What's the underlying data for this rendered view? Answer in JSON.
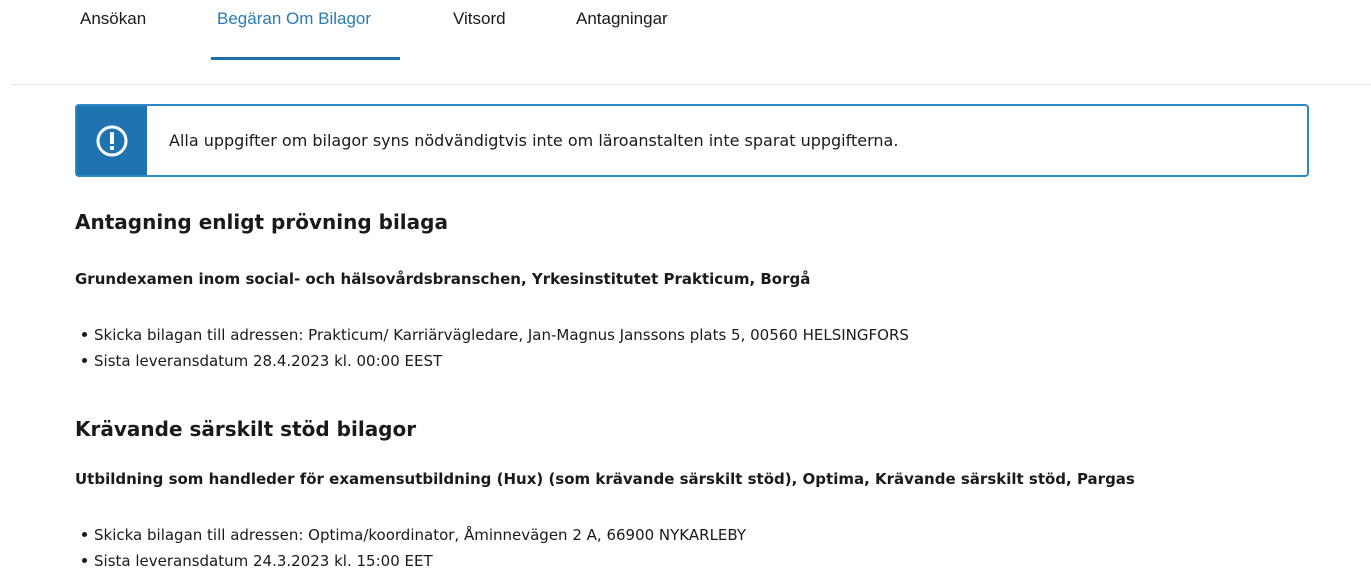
{
  "tabs": [
    {
      "label": "Ansökan",
      "active": false
    },
    {
      "label": "Begäran Om Bilagor",
      "active": true
    },
    {
      "label": "Vitsord",
      "active": false
    },
    {
      "label": "Antagningar",
      "active": false
    }
  ],
  "notice": {
    "icon": "exclamation-circle-icon",
    "text": "Alla uppgifter om bilagor syns nödvändigtvis inte om läroanstalten inte sparat uppgifterna."
  },
  "sections": [
    {
      "heading": "Antagning enligt prövning bilaga",
      "subheading": "Grundexamen inom social- och hälsovårdsbranschen, Yrkesinstitutet Prakticum, Borgå",
      "items": [
        "Skicka bilagan till adressen: Prakticum/ Karriärvägledare, Jan-Magnus Janssons plats 5, 00560 HELSINGFORS",
        "Sista leveransdatum 28.4.2023 kl. 00:00 EEST"
      ]
    },
    {
      "heading": "Krävande särskilt stöd bilagor",
      "subheading": "Utbildning som handleder för examensutbildning (Hux) (som krävande särskilt stöd), Optima, Krävande särskilt stöd, Pargas",
      "items": [
        "Skicka bilagan till adressen: Optima/koordinator, Åminnevägen 2 A, 66900 NYKARLEBY",
        "Sista leveransdatum 24.3.2023 kl. 15:00 EET"
      ]
    }
  ],
  "colors": {
    "accent": "#2a7bb5",
    "notice_border": "#2c88c6",
    "notice_icon_bg": "#1f73b0"
  }
}
